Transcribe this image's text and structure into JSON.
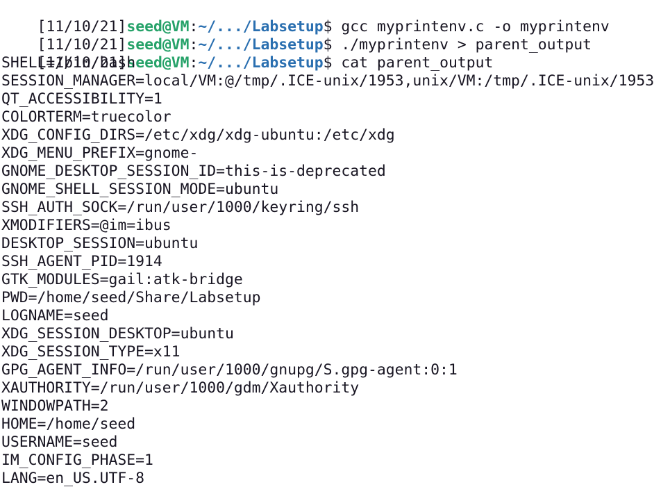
{
  "prompt": {
    "time": "[11/10/21]",
    "user_host": "seed@VM",
    "colon": ":",
    "path": "~/.../Labsetup",
    "dollar": "$ "
  },
  "commands": [
    "gcc myprintenv.c -o myprintenv",
    "./myprintenv > parent_output",
    "cat parent_output"
  ],
  "output": [
    "SHELL=/bin/bash",
    "SESSION_MANAGER=local/VM:@/tmp/.ICE-unix/1953,unix/VM:/tmp/.ICE-unix/1953",
    "QT_ACCESSIBILITY=1",
    "COLORTERM=truecolor",
    "XDG_CONFIG_DIRS=/etc/xdg/xdg-ubuntu:/etc/xdg",
    "XDG_MENU_PREFIX=gnome-",
    "GNOME_DESKTOP_SESSION_ID=this-is-deprecated",
    "GNOME_SHELL_SESSION_MODE=ubuntu",
    "SSH_AUTH_SOCK=/run/user/1000/keyring/ssh",
    "XMODIFIERS=@im=ibus",
    "DESKTOP_SESSION=ubuntu",
    "SSH_AGENT_PID=1914",
    "GTK_MODULES=gail:atk-bridge",
    "PWD=/home/seed/Share/Labsetup",
    "LOGNAME=seed",
    "XDG_SESSION_DESKTOP=ubuntu",
    "XDG_SESSION_TYPE=x11",
    "GPG_AGENT_INFO=/run/user/1000/gnupg/S.gpg-agent:0:1",
    "XAUTHORITY=/run/user/1000/gdm/Xauthority",
    "WINDOWPATH=2",
    "HOME=/home/seed",
    "USERNAME=seed",
    "IM_CONFIG_PHASE=1",
    "LANG=en_US.UTF-8"
  ],
  "colors": {
    "background": "#ffffff",
    "text": "#171421",
    "user_host": "#26a269",
    "path": "#2a6fb0"
  }
}
